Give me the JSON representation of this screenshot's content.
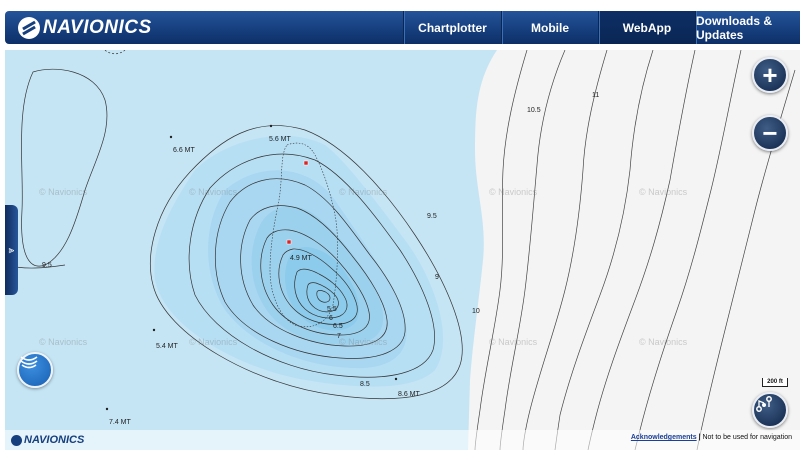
{
  "header": {
    "brand": "NAVIONICS",
    "tabs": [
      {
        "label": "Chartplotter",
        "active": false
      },
      {
        "label": "Mobile",
        "active": false
      },
      {
        "label": "WebApp",
        "active": true
      },
      {
        "label": "Downloads & Updates",
        "active": false
      }
    ]
  },
  "map": {
    "depth_labels": [
      "6.6 MT",
      "5.6 MT",
      "4.9 MT",
      "5.4 MT",
      "8.6 MT",
      "7.4 MT"
    ],
    "contour_labels": [
      "10.5",
      "11",
      "9.5",
      "9",
      "10",
      "9.5",
      "5.5",
      "6",
      "6.5",
      "7",
      "8.5"
    ],
    "watermark": "© Navionics",
    "scale_label": "200 ft",
    "colors": {
      "water_light": "#c5e5f5",
      "water_mid": "#a9d7f1",
      "water_deep": "#8ccbeb",
      "land": "#f4f4f4",
      "brand": "#163f7e"
    }
  },
  "controls": {
    "zoom_in": "+",
    "zoom_out": "−",
    "sidebar_toggle_icon": "chevron-right-icon",
    "sonar_icon": "sonar-icon",
    "route_icon": "route-icon"
  },
  "footer": {
    "brand": "NAVIONICS",
    "acknowledgements": "Acknowledgements",
    "separator": "|",
    "disclaimer": "Not to be used for navigation"
  }
}
